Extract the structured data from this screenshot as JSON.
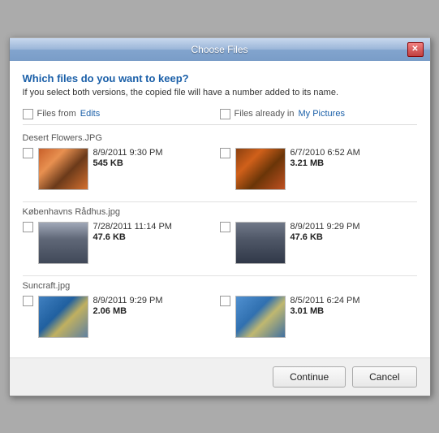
{
  "window": {
    "title": "Choose Files",
    "close_label": "✕"
  },
  "header": {
    "question": "Which files do you want to keep?",
    "subtitle": "If you select both versions, the copied file will have a number added to its name."
  },
  "columns": {
    "left_prefix": "Files from ",
    "left_link": "Edits",
    "right_prefix": "Files already in ",
    "right_link": "My Pictures"
  },
  "files": [
    {
      "name": "Desert Flowers.JPG",
      "left": {
        "datetime": "8/9/2011 9:30 PM",
        "size": "545 KB",
        "thumb_class": "thumb-desert-l"
      },
      "right": {
        "datetime": "6/7/2010 6:52 AM",
        "size": "3.21 MB",
        "thumb_class": "thumb-desert-r"
      }
    },
    {
      "name": "Københavns Rådhus.jpg",
      "left": {
        "datetime": "7/28/2011 11:14 PM",
        "size": "47.6 KB",
        "thumb_class": "thumb-kob-l"
      },
      "right": {
        "datetime": "8/9/2011 9:29 PM",
        "size": "47.6 KB",
        "thumb_class": "thumb-kob-r"
      }
    },
    {
      "name": "Suncraft.jpg",
      "left": {
        "datetime": "8/9/2011 9:29 PM",
        "size": "2.06 MB",
        "thumb_class": "thumb-sun-l"
      },
      "right": {
        "datetime": "8/5/2011 6:24 PM",
        "size": "3.01 MB",
        "thumb_class": "thumb-sun-r"
      }
    }
  ],
  "footer": {
    "continue_label": "Continue",
    "cancel_label": "Cancel"
  }
}
